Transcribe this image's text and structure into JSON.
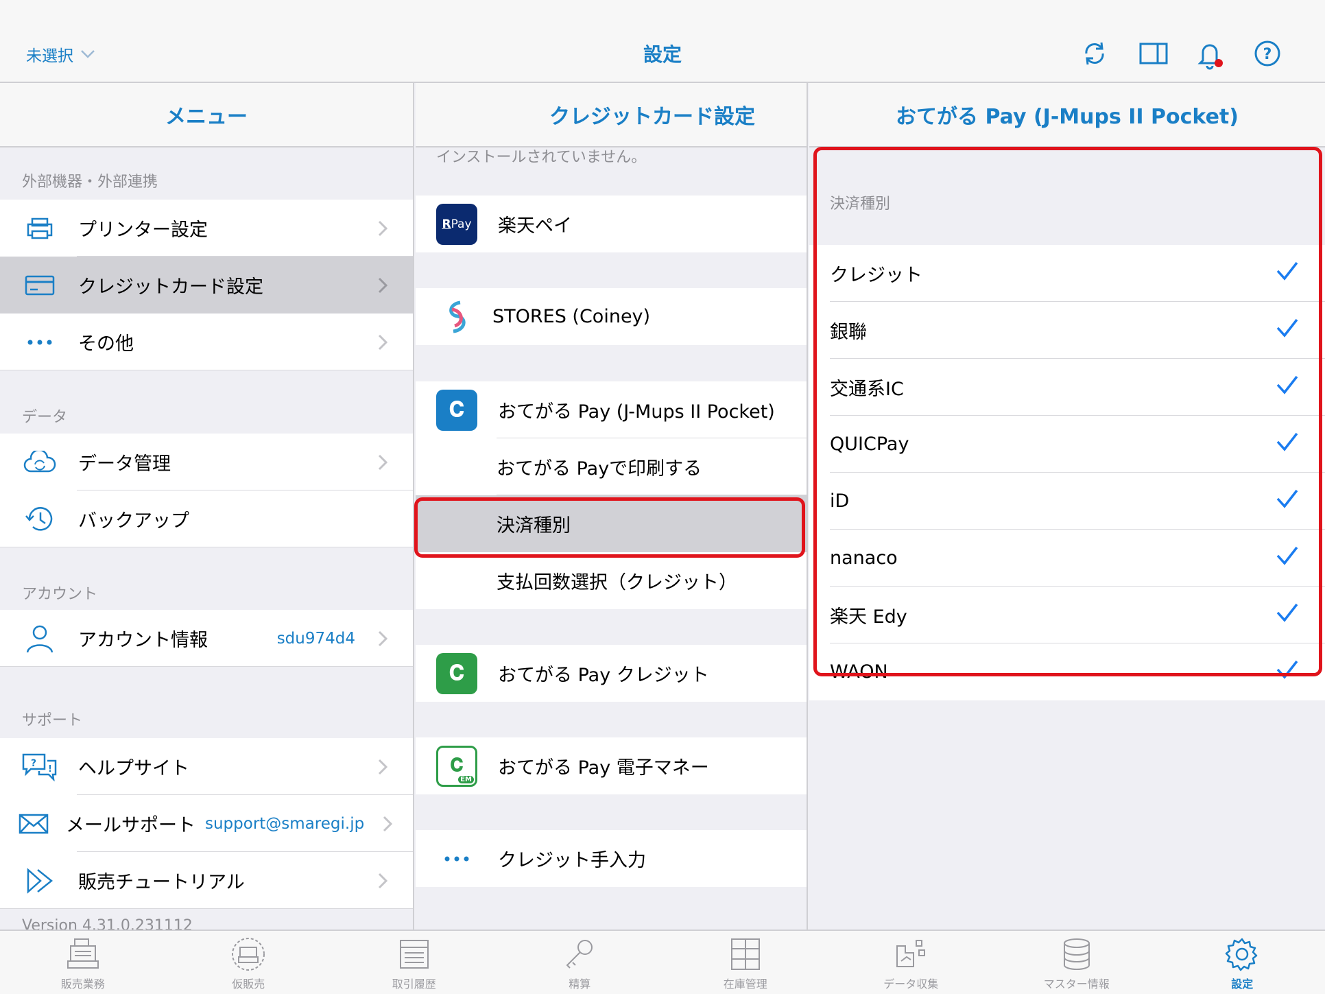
{
  "nav": {
    "left_label": "未選択",
    "title": "設定",
    "icons": [
      "refresh-icon",
      "split-view-icon",
      "bell-icon",
      "help-icon"
    ]
  },
  "menu": {
    "header": "メニュー",
    "sections": [
      {
        "title": "外部機器・外部連携",
        "items": [
          {
            "label": "プリンター設定",
            "icon": "printer-icon"
          },
          {
            "label": "クレジットカード設定",
            "icon": "credit-card-icon",
            "selected": true
          },
          {
            "label": "その他",
            "icon": "more-icon"
          }
        ]
      },
      {
        "title": "データ",
        "items": [
          {
            "label": "データ管理",
            "icon": "cloud-sync-icon"
          },
          {
            "label": "バックアップ",
            "icon": "history-icon"
          }
        ]
      },
      {
        "title": "アカウント",
        "items": [
          {
            "label": "アカウント情報",
            "value": "sdu974d4",
            "icon": "person-icon"
          }
        ]
      },
      {
        "title": "サポート",
        "items": [
          {
            "label": "ヘルプサイト",
            "icon": "help-chat-icon"
          },
          {
            "label": "メールサポート",
            "value": "support@smaregi.jp",
            "icon": "mail-icon"
          },
          {
            "label": "販売チュートリアル",
            "icon": "forward-icon"
          }
        ]
      }
    ],
    "version": "Version 4.31.0.231112"
  },
  "credit": {
    "header": "クレジットカード設定",
    "note": "インストールされていません。",
    "items": {
      "rakuten_pay": "楽天ペイ",
      "rakuten_pay_badge": "Pay",
      "stores": "STORES (Coiney)",
      "otegaru_jmups": "おてがる Pay (J-Mups II Pocket)",
      "otegaru_print": "おてがる Payで印刷する",
      "payment_type": "決済種別",
      "installments": "支払回数選択（クレジット）",
      "otegaru_credit": "おてがる Pay クレジット",
      "otegaru_emoney": "おてがる Pay 電子マネー",
      "manual_credit": "クレジット手入力"
    }
  },
  "detail": {
    "header": "おてがる Pay (J-Mups II Pocket)",
    "section": "決済種別",
    "types": [
      {
        "label": "クレジット",
        "checked": true
      },
      {
        "label": "銀聯",
        "checked": true
      },
      {
        "label": "交通系IC",
        "checked": true
      },
      {
        "label": "QUICPay",
        "checked": true
      },
      {
        "label": "iD",
        "checked": true
      },
      {
        "label": "nanaco",
        "checked": true
      },
      {
        "label": "楽天 Edy",
        "checked": true
      },
      {
        "label": "WAON",
        "checked": true
      }
    ]
  },
  "tabs": [
    {
      "label": "販売業務",
      "icon": "register-icon"
    },
    {
      "label": "仮販売",
      "icon": "temp-sale-icon"
    },
    {
      "label": "取引履歴",
      "icon": "history-list-icon"
    },
    {
      "label": "精算",
      "icon": "key-icon"
    },
    {
      "label": "在庫管理",
      "icon": "inventory-icon"
    },
    {
      "label": "データ収集",
      "icon": "data-collect-icon"
    },
    {
      "label": "マスター情報",
      "icon": "database-icon"
    },
    {
      "label": "設定",
      "icon": "gear-icon",
      "active": true
    }
  ],
  "colors": {
    "accent": "#1a7fc6",
    "highlight": "#e0141c",
    "selected": "#d1d1d6"
  }
}
